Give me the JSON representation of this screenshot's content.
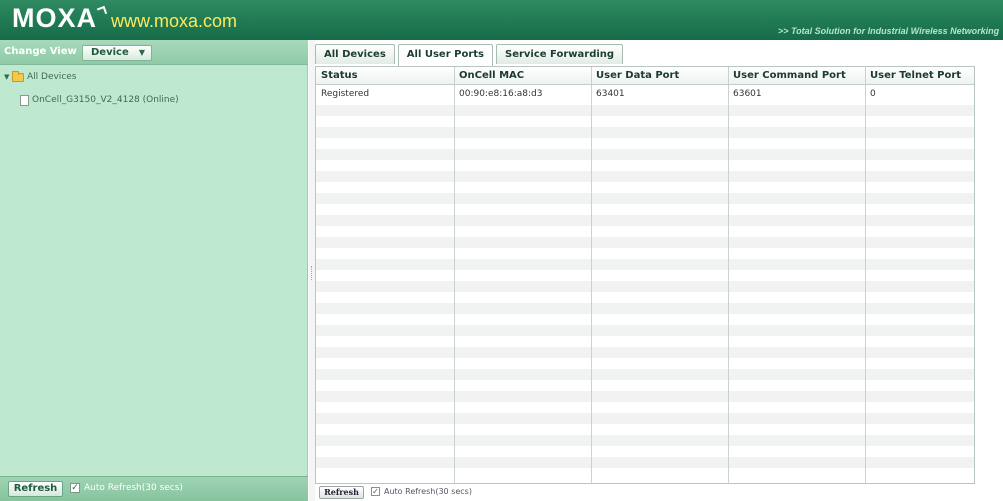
{
  "header": {
    "logo_text": "MOXA",
    "logo_url": "www.moxa.com",
    "tagline": ">> Total Solution for Industrial Wireless Networking"
  },
  "left_panel": {
    "change_view_label": "Change View",
    "view_select_value": "Device",
    "tree": {
      "root_label": "All Devices",
      "children": [
        {
          "label": "OnCell_G3150_V2_4128 (Online)"
        }
      ]
    },
    "refresh_label": "Refresh",
    "auto_refresh_label": "Auto Refresh(30 secs)",
    "auto_refresh_checked": true
  },
  "tabs": [
    {
      "label": "All Devices",
      "active": false
    },
    {
      "label": "All User Ports",
      "active": true
    },
    {
      "label": "Service Forwarding",
      "active": false
    }
  ],
  "grid": {
    "columns": [
      "Status",
      "OnCell MAC",
      "User Data Port",
      "User Command Port",
      "User Telnet Port"
    ],
    "rows": [
      [
        "Registered",
        "00:90:e8:16:a8:d3",
        "63401",
        "63601",
        "0"
      ]
    ]
  },
  "bottom": {
    "refresh_label": "Refresh",
    "auto_refresh_label": "Auto Refresh(30 secs)",
    "auto_refresh_checked": true
  },
  "colors": {
    "header_green": "#1f7a54",
    "panel_green": "#bfe8d0",
    "logo_url_yellow": "#ffe85a"
  }
}
